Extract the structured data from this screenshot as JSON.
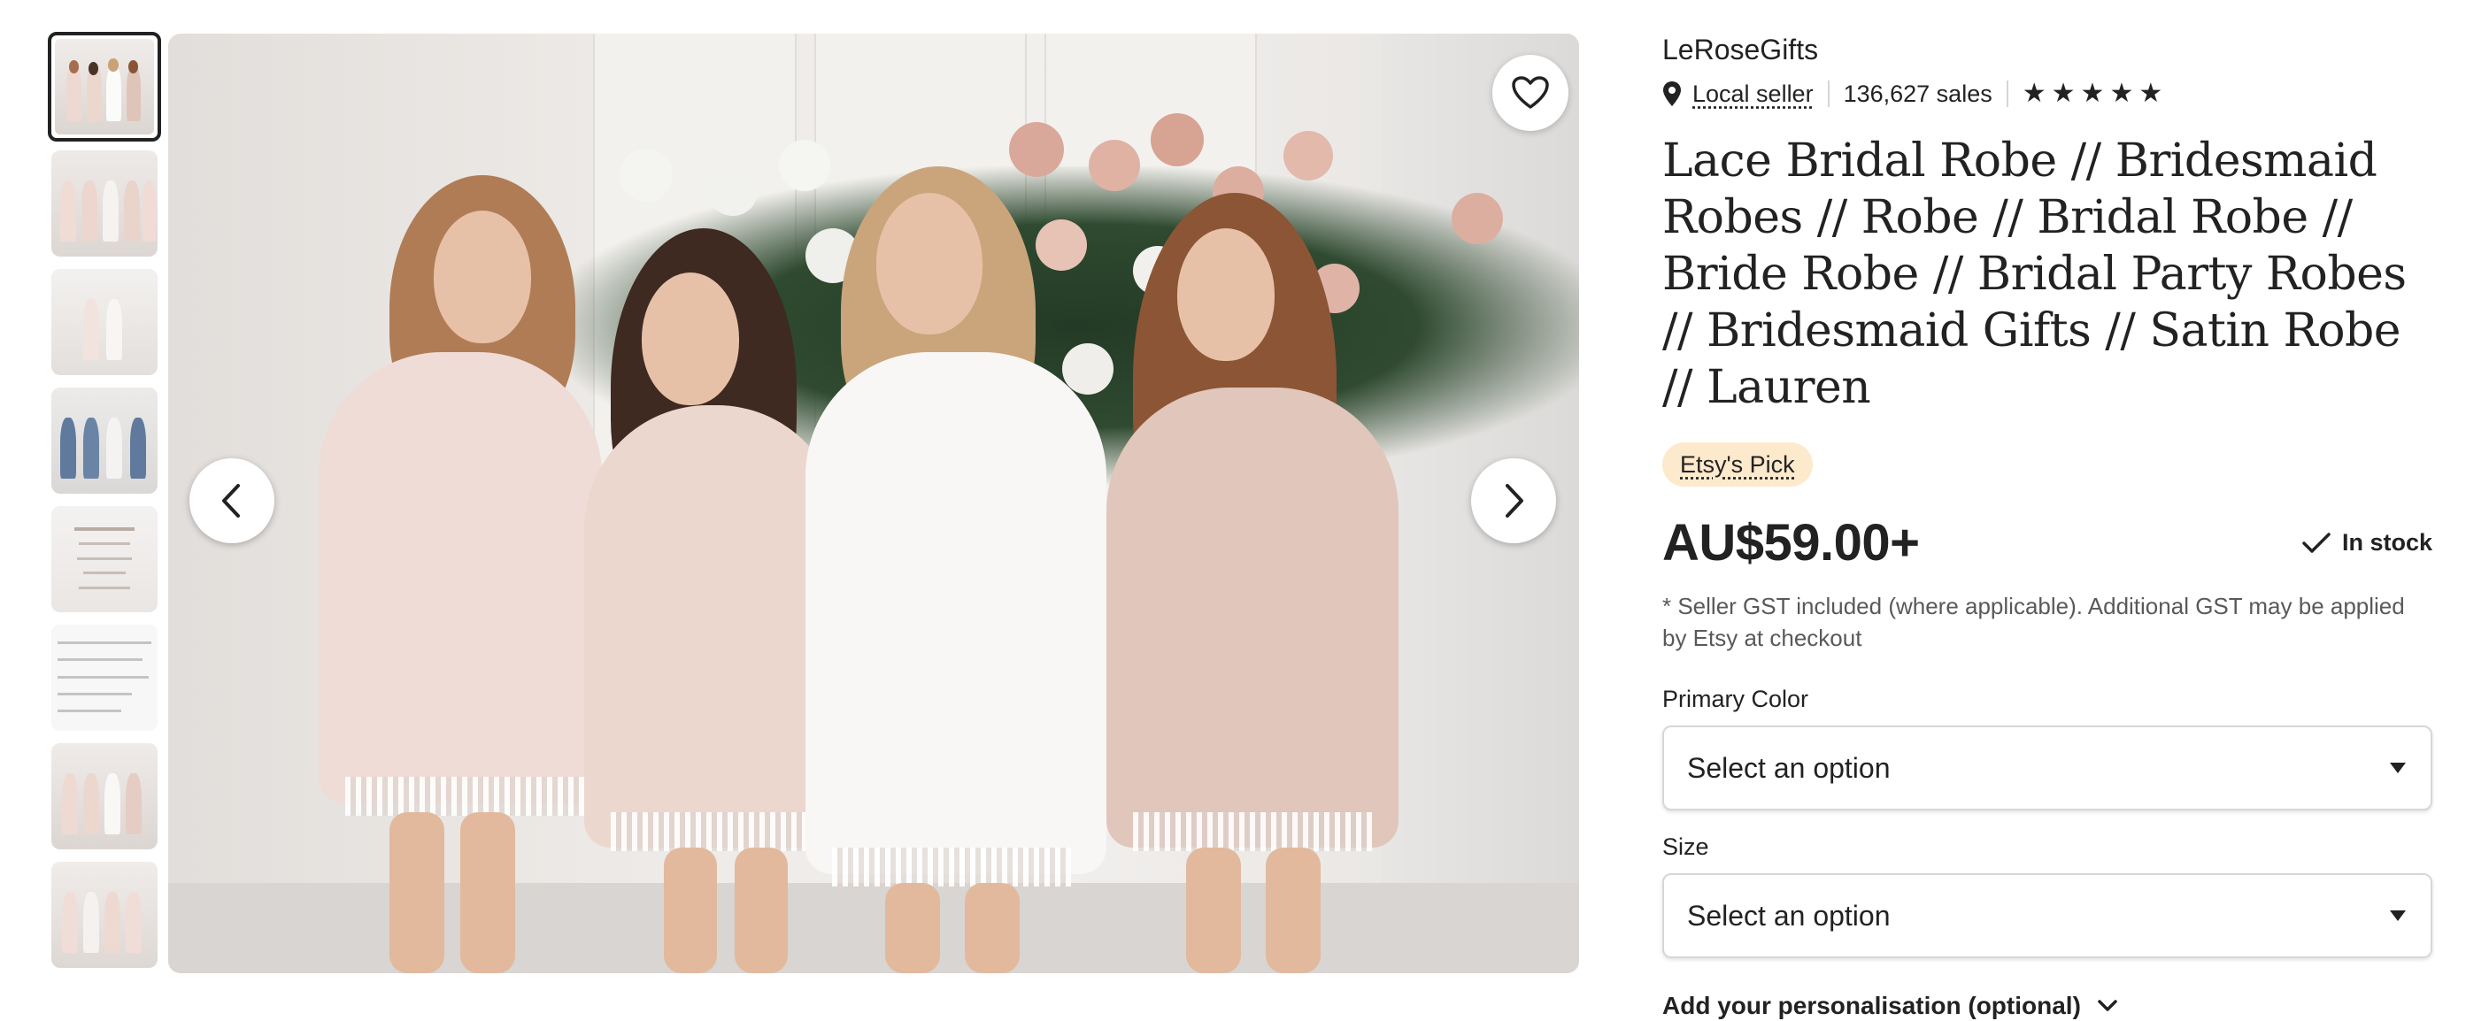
{
  "shop": {
    "name": "LeRoseGifts",
    "local_seller": "Local seller",
    "sales": "136,627 sales",
    "rating_stars": 5
  },
  "listing": {
    "title": "Lace Bridal Robe // Bridesmaid Robes // Robe // Bridal Robe // Bride Robe // Bridal Party Robes // Bridesmaid Gifts // Satin Robe // Lauren",
    "badge": "Etsy's Pick",
    "price": "AU$59.00+",
    "stock": "In stock",
    "tax_note": "* Seller GST included (where applicable). Additional GST may be applied by Etsy at checkout"
  },
  "options": {
    "primary_color": {
      "label": "Primary Color",
      "value": "Select an option"
    },
    "size": {
      "label": "Size",
      "value": "Select an option"
    },
    "personalisation": "Add your personalisation (optional)"
  },
  "gallery": {
    "thumbnails": [
      "thumb-1",
      "thumb-2",
      "thumb-3",
      "thumb-4",
      "thumb-5",
      "thumb-6",
      "thumb-7",
      "thumb-8"
    ],
    "active_index": 0
  },
  "colors": {
    "accent_text": "#222222",
    "badge_bg": "#fde9cc",
    "robe_blush": "#efdcd6",
    "robe_white": "#f8f7f5",
    "robe_nude": "#e0c6bb"
  },
  "icons": {
    "favorite": "heart-icon",
    "prev": "chevron-left-icon",
    "next": "chevron-right-icon",
    "location": "map-pin-icon",
    "rating": "star-icon",
    "stock": "check-icon",
    "select": "caret-down-icon",
    "personalise": "chevron-down-icon"
  }
}
